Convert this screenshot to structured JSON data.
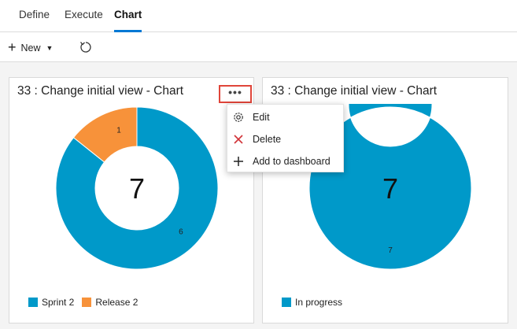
{
  "tabs": [
    {
      "label": "Define",
      "active": false
    },
    {
      "label": "Execute",
      "active": false
    },
    {
      "label": "Chart",
      "active": true
    }
  ],
  "toolbar": {
    "new_label": "New",
    "plus_icon": "plus-icon",
    "caret_icon": "caret-down-icon",
    "refresh_icon": "refresh-icon"
  },
  "colors": {
    "accent": "#0078d4",
    "series_blue": "#0099c9",
    "series_orange": "#f7923a",
    "highlight_red": "#e0453a"
  },
  "cards": [
    {
      "title": "33 : Change initial view - Chart",
      "total": "7",
      "legend": [
        {
          "label": "Sprint 2",
          "color": "#0099c9"
        },
        {
          "label": "Release 2",
          "color": "#f7923a"
        }
      ]
    },
    {
      "title": "33 : Change initial view - Chart",
      "total": "7",
      "legend": [
        {
          "label": "In progress",
          "color": "#0099c9"
        }
      ]
    }
  ],
  "chart_data": [
    {
      "type": "pie",
      "title": "33 : Change initial view - Chart",
      "categories": [
        "Sprint 2",
        "Release 2"
      ],
      "values": [
        6,
        1
      ],
      "center_label": "7",
      "legend": "bottom-left"
    },
    {
      "type": "pie",
      "title": "33 : Change initial view - Chart",
      "categories": [
        "In progress"
      ],
      "values": [
        7
      ],
      "center_label": "7",
      "legend": "bottom-left"
    }
  ],
  "more_button": {
    "label": "•••"
  },
  "context_menu": {
    "items": [
      {
        "label": "Edit",
        "icon": "gear-icon"
      },
      {
        "label": "Delete",
        "icon": "close-icon"
      },
      {
        "label": "Add to dashboard",
        "icon": "plus-icon"
      }
    ]
  }
}
